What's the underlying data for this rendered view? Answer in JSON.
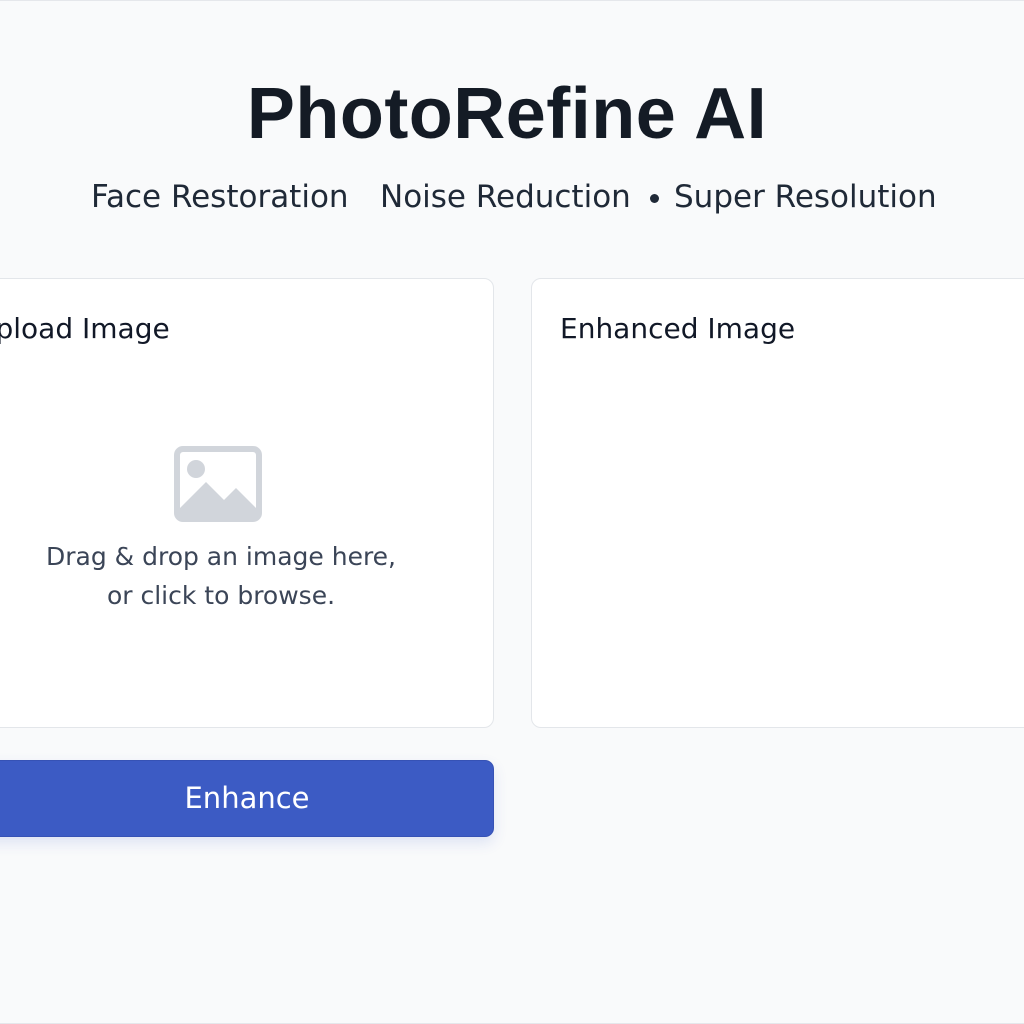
{
  "header": {
    "title": "PhotoRefine AI",
    "features": [
      "Face Restoration",
      "Noise Reduction",
      "Super Resolution"
    ]
  },
  "upload_panel": {
    "title": "Upload Image",
    "icon": "image-placeholder-icon",
    "drop_text_line1": "Drag & drop an image here,",
    "drop_text_line2": "or click to browse."
  },
  "enhanced_panel": {
    "title": "Enhanced Image"
  },
  "actions": {
    "enhance_label": "Enhance"
  },
  "colors": {
    "background": "#f9fafb",
    "accent": "#3c5bc4",
    "title_text": "#141b25",
    "muted_text": "#3b4557",
    "icon_gray": "#d1d5db",
    "panel_border": "#e3e6ea"
  }
}
